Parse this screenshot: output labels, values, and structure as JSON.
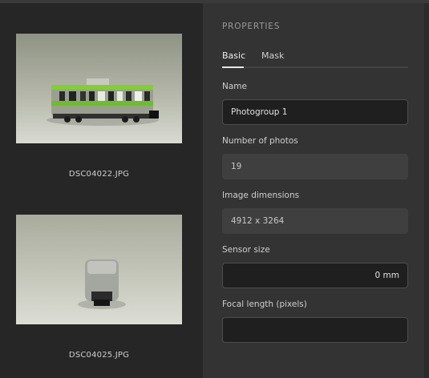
{
  "photos": [
    {
      "filename": "DSC04022.JPG",
      "subject": "green and silver toy train car, side view"
    },
    {
      "filename": "DSC04025.JPG",
      "subject": "toy train car, end view"
    }
  ],
  "properties": {
    "title": "PROPERTIES",
    "tabs": [
      {
        "label": "Basic",
        "active": true
      },
      {
        "label": "Mask",
        "active": false
      }
    ],
    "fields": {
      "name": {
        "label": "Name",
        "value": "Photogroup 1"
      },
      "num_photos": {
        "label": "Number of photos",
        "value": "19"
      },
      "image_dimensions": {
        "label": "Image dimensions",
        "value": "4912 x 3264"
      },
      "sensor_size": {
        "label": "Sensor size",
        "value": "0 mm"
      },
      "focal_length": {
        "label": "Focal length (pixels)",
        "value": ""
      }
    }
  },
  "colors": {
    "panel_dark": "#262626",
    "panel_properties": "#333333",
    "accent_tab": "#e6e6e6"
  }
}
